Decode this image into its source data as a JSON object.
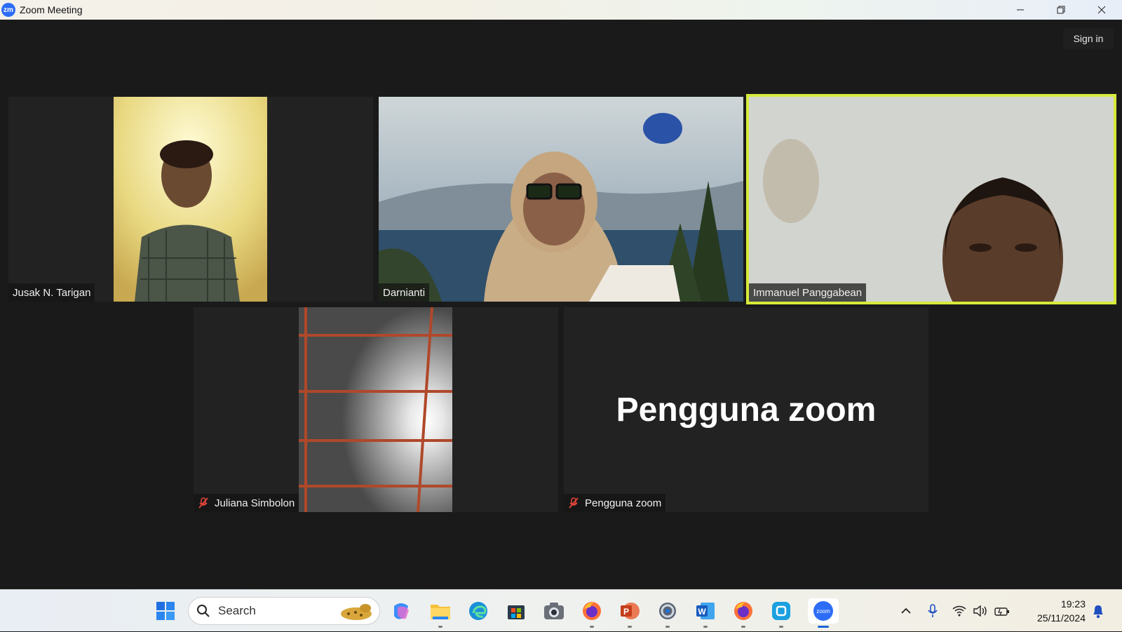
{
  "window": {
    "title": "Zoom Meeting",
    "logo_text": "zm"
  },
  "header": {
    "sign_in_label": "Sign in"
  },
  "participants": [
    {
      "name": "Jusak N. Tarigan",
      "muted": false
    },
    {
      "name": "Darnianti",
      "muted": false
    },
    {
      "name": "Immanuel Panggabean",
      "muted": false,
      "active_speaker": true
    },
    {
      "name": "Juliana Simbolon",
      "muted": true
    },
    {
      "name": "Pengguna zoom",
      "muted": true,
      "video_off_label": "Pengguna zoom"
    }
  ],
  "taskbar": {
    "search_placeholder": "Search",
    "apps": [
      "start-icon",
      "copilot-icon",
      "file-explorer-icon",
      "edge-icon",
      "store-icon",
      "camera-icon",
      "firefox-icon",
      "powerpoint-icon",
      "settings-icon",
      "word-icon",
      "firefox-icon",
      "app-icon",
      "zoom-icon"
    ],
    "clock": {
      "time": "19:23",
      "date": "25/11/2024"
    }
  },
  "colors": {
    "active_border": "#d6ea3a",
    "zoom_blue": "#2d6df6",
    "mute_red": "#e0453a"
  }
}
